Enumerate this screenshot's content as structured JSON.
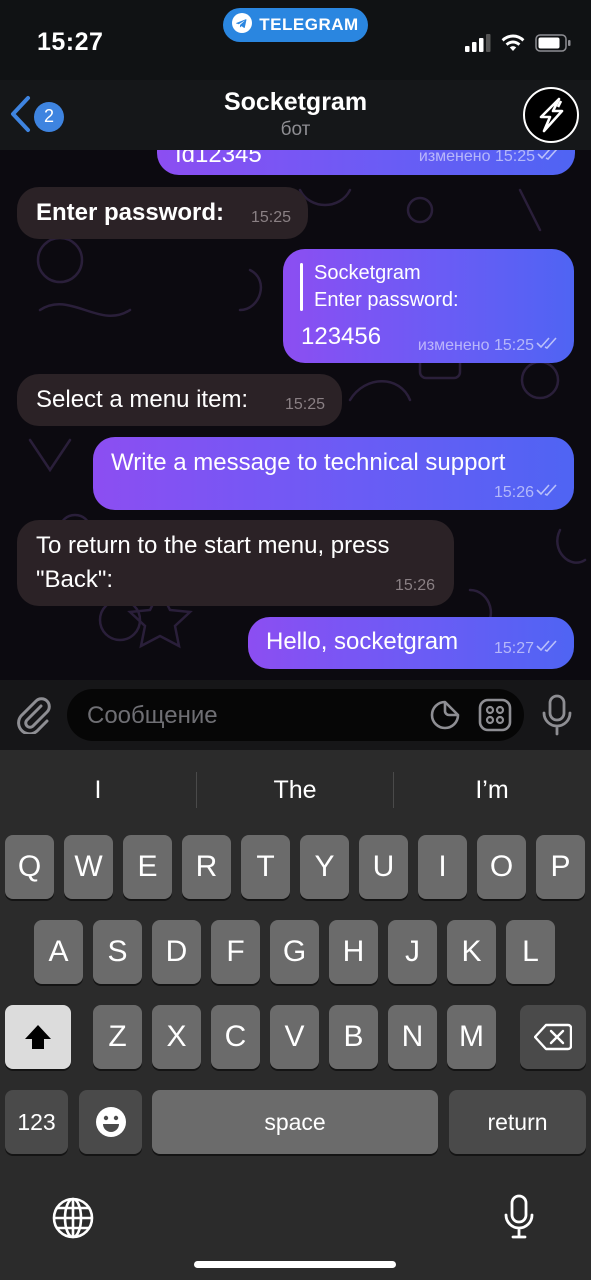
{
  "status_bar": {
    "time": "15:27",
    "app_pill": "TELEGRAM"
  },
  "nav": {
    "back_badge": "2",
    "title": "Socketgram",
    "subtitle": "бот"
  },
  "messages": [
    {
      "id": "m0",
      "side": "out",
      "text": "Id12345",
      "meta": "изменено 15:25"
    },
    {
      "id": "m1",
      "side": "in",
      "text": "Enter password:",
      "meta": "15:25"
    },
    {
      "id": "m2",
      "side": "out",
      "reply_author": "Socketgram",
      "reply_text": "Enter password:",
      "text": "123456",
      "meta": "изменено 15:25"
    },
    {
      "id": "m3",
      "side": "in",
      "text": "Select a menu item:",
      "meta": "15:25"
    },
    {
      "id": "m4",
      "side": "out",
      "text": "Write a message to technical support",
      "meta": "15:26"
    },
    {
      "id": "m5",
      "side": "in",
      "text_line1": "To return to the start menu, press",
      "text_line2": "\"Back\":",
      "meta": "15:26"
    },
    {
      "id": "m6",
      "side": "out",
      "text": "Hello, socketgram",
      "meta": "15:27"
    }
  ],
  "composer": {
    "placeholder": "Сообщение"
  },
  "keyboard": {
    "suggestions": [
      "I",
      "The",
      "I’m"
    ],
    "row1": [
      "Q",
      "W",
      "E",
      "R",
      "T",
      "Y",
      "U",
      "I",
      "O",
      "P"
    ],
    "row2": [
      "A",
      "S",
      "D",
      "F",
      "G",
      "H",
      "J",
      "K",
      "L"
    ],
    "row3": [
      "Z",
      "X",
      "C",
      "V",
      "B",
      "N",
      "M"
    ],
    "numbers_key": "123",
    "space_key": "space",
    "return_key": "return"
  },
  "colors": {
    "outgoing_gradient": [
      "#8c4ef2",
      "#4f64f3"
    ],
    "incoming": "#2b2226",
    "accent": "#3e84e0"
  }
}
